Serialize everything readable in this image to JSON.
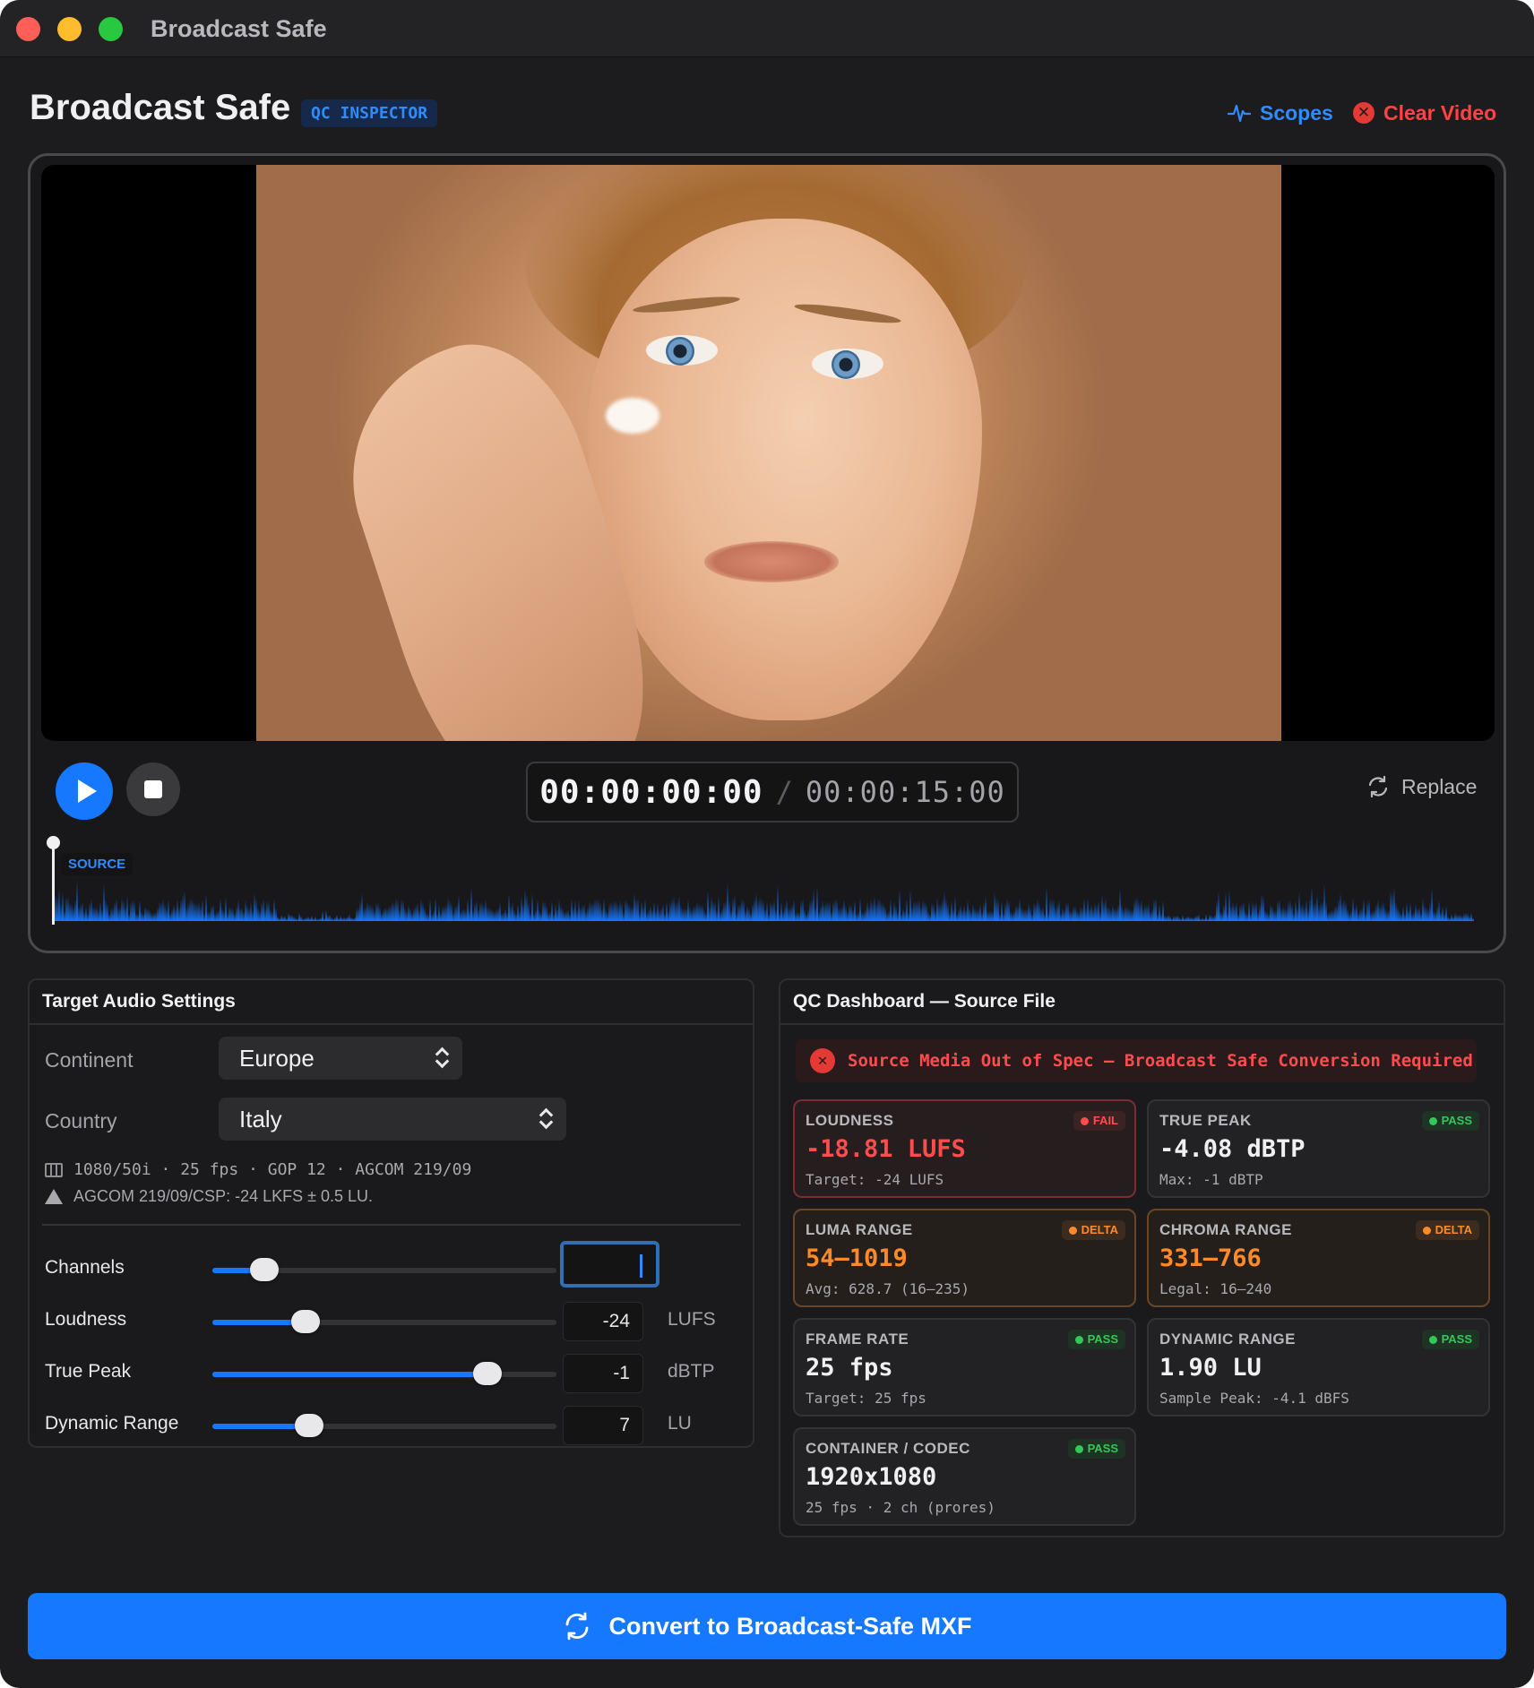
{
  "window": {
    "title": "Broadcast Safe"
  },
  "header": {
    "app_title": "Broadcast Safe",
    "badge": "QC INSPECTOR",
    "scopes_label": "Scopes",
    "clear_label": "Clear Video"
  },
  "player": {
    "timecode_current": "00:00:00:00",
    "timecode_separator": "/",
    "timecode_duration": "00:00:15:00",
    "replace_label": "Replace",
    "track_tag": "SOURCE",
    "playhead_fraction": 0
  },
  "audio_settings": {
    "title": "Target Audio Settings",
    "continent_label": "Continent",
    "continent_value": "Europe",
    "country_label": "Country",
    "country_value": "Italy",
    "format_info": "1080/50i · 25 fps · GOP 12 · AGCOM 219/09",
    "standard_info": "AGCOM 219/09/CSP: -24 LKFS ± 0.5 LU.",
    "sliders": [
      {
        "label": "Channels",
        "value": "",
        "unit": "",
        "level": 0.15
      },
      {
        "label": "Loudness",
        "value": "-24",
        "unit": "LUFS",
        "level": 0.27
      },
      {
        "label": "True Peak",
        "value": "-1",
        "unit": "dBTP",
        "level": 0.8
      },
      {
        "label": "Dynamic Range",
        "value": "7",
        "unit": "LU",
        "level": 0.28
      }
    ]
  },
  "qc": {
    "title": "QC Dashboard — Source File",
    "alert": "Source Media Out of Spec — Broadcast Safe Conversion Required",
    "cards": [
      {
        "key": "LOUDNESS",
        "status": "FAIL",
        "value": "-18.81 LUFS",
        "sub": "Target: -24 LUFS"
      },
      {
        "key": "TRUE PEAK",
        "status": "PASS",
        "value": "-4.08 dBTP",
        "sub": "Max: -1 dBTP"
      },
      {
        "key": "LUMA RANGE",
        "status": "DELTA",
        "value": "54–1019",
        "sub": "Avg: 628.7 (16–235)"
      },
      {
        "key": "CHROMA RANGE",
        "status": "DELTA",
        "value": "331–766",
        "sub": "Legal: 16–240"
      },
      {
        "key": "FRAME RATE",
        "status": "PASS",
        "value": "25 fps",
        "sub": "Target: 25 fps"
      },
      {
        "key": "DYNAMIC RANGE",
        "status": "PASS",
        "value": "1.90 LU",
        "sub": "Sample Peak: -4.1 dBFS"
      },
      {
        "key": "CONTAINER / CODEC",
        "status": "PASS",
        "value": "1920x1080",
        "sub": "25 fps · 2 ch (prores)"
      }
    ]
  },
  "convert_label": "Convert to Broadcast-Safe MXF",
  "colors": {
    "accent": "#1677ff",
    "fail": "#ff4d4f",
    "delta": "#ff8a2a",
    "pass": "#34c759"
  }
}
